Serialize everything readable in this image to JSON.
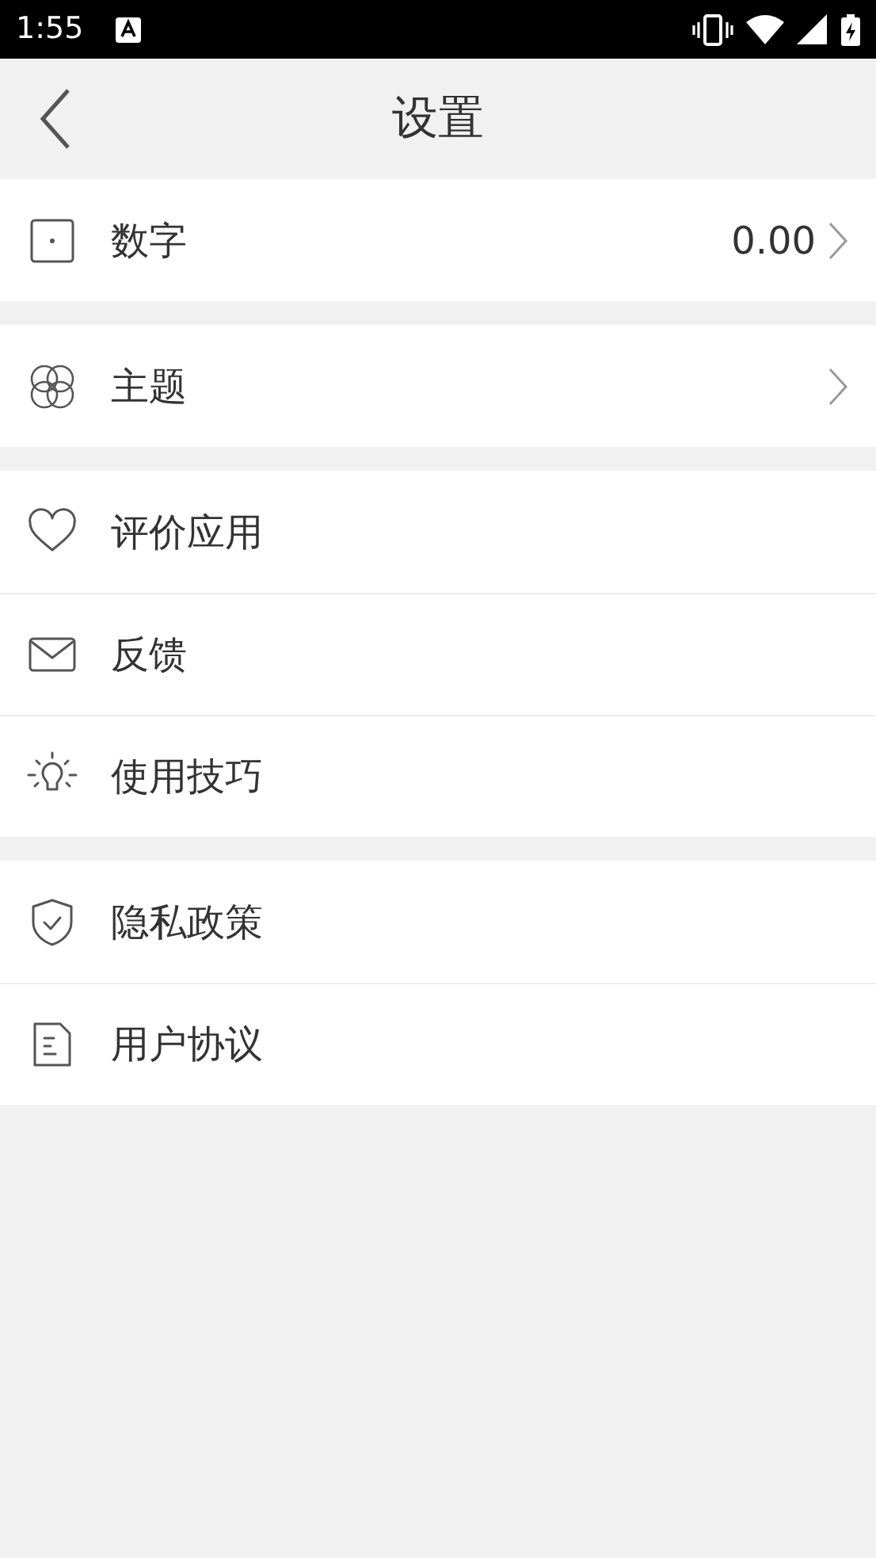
{
  "status_bar": {
    "time": "1:55"
  },
  "header": {
    "title": "设置"
  },
  "groups": [
    {
      "items": [
        {
          "label": "数字",
          "value": "0.00",
          "chevron": true
        }
      ]
    },
    {
      "items": [
        {
          "label": "主题",
          "chevron": true
        }
      ]
    },
    {
      "items": [
        {
          "label": "评价应用",
          "chevron": false
        },
        {
          "label": "反馈",
          "chevron": false
        },
        {
          "label": "使用技巧",
          "chevron": false
        }
      ]
    },
    {
      "items": [
        {
          "label": "隐私政策",
          "chevron": false
        },
        {
          "label": "用户协议",
          "chevron": false
        }
      ]
    }
  ]
}
